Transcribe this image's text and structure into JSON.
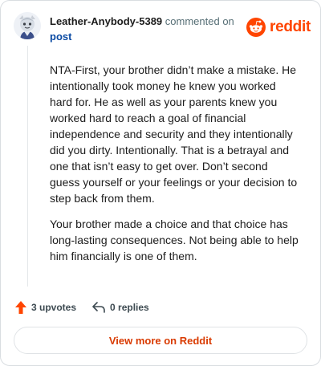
{
  "comment": {
    "username": "Leather-Anybody-5389",
    "commented_on_text": "commented on",
    "post_link_text": "post",
    "paragraphs": [
      "NTA-First, your brother didn’t make a mistake. He intentionally took money he knew you worked hard for. He as well as your parents knew you worked hard to reach a goal of financial independence and security and they intentionally did you dirty. Intentionally. That is a betrayal and one that isn’t easy to get over. Don’t second guess yourself or your feelings or your decision to step back from them.",
      "Your brother made a choice and that choice has long-lasting consequences. Not being able to help him financially is one of them."
    ]
  },
  "brand": {
    "wordmark": "reddit",
    "icon": "reddit-alien-icon",
    "color": "#ff4500"
  },
  "actions": {
    "upvotes_label": "3 upvotes",
    "replies_label": "0 replies",
    "upvote_icon": "upvote-arrow-icon",
    "reply_icon": "reply-arrow-icon",
    "upvote_color": "#ff4500"
  },
  "footer": {
    "view_more_label": "View more on Reddit"
  }
}
